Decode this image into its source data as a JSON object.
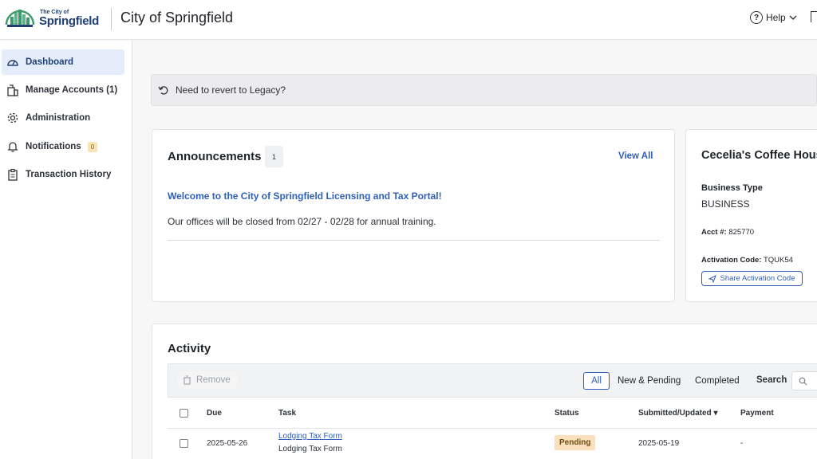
{
  "header": {
    "logo_small": "The City of",
    "logo_big": "Springfield",
    "title": "City of Springfield",
    "help_label": "Help"
  },
  "sidebar": {
    "items": [
      {
        "label": "Dashboard",
        "icon": "gauge-icon",
        "active": true
      },
      {
        "label": "Manage Accounts (1)",
        "icon": "building-icon"
      },
      {
        "label": "Administration",
        "icon": "gear-icon"
      },
      {
        "label": "Notifications",
        "icon": "bell-icon",
        "badge": "0"
      },
      {
        "label": "Transaction History",
        "icon": "clipboard-icon"
      }
    ]
  },
  "legacy_banner": {
    "text": "Need to revert to Legacy?"
  },
  "announcements": {
    "title": "Announcements",
    "count": "1",
    "view_all": "View All",
    "heading": "Welcome to the City of Springfield Licensing and Tax Portal!",
    "body": "Our offices will be closed from 02/27 - 02/28 for annual training."
  },
  "business": {
    "name": "Cecelia's Coffee House",
    "type_label": "Business Type",
    "type_value": "BUSINESS",
    "acct_label": "Acct #:",
    "acct_value": "825770",
    "activation_label": "Activation Code:",
    "activation_value": "TQUK54",
    "share_button": "Share Activation Code"
  },
  "activity": {
    "title": "Activity",
    "remove_button": "Remove",
    "filters": [
      "All",
      "New & Pending",
      "Completed"
    ],
    "active_filter": "All",
    "search_label": "Search",
    "columns": [
      "Due",
      "Task",
      "Status",
      "Submitted/Updated ▾",
      "Payment"
    ],
    "rows": [
      {
        "due": "2025-05-26",
        "task_link": "Lodging Tax Form",
        "task_sub": "Lodging Tax Form",
        "status": "Pending",
        "submitted": "2025-05-19",
        "payment": "-"
      }
    ]
  },
  "colors": {
    "accent": "#2f5fb8",
    "brand_navy": "#1f3f75",
    "pending_bg": "#fbe0bd",
    "active_nav_bg": "#e5edfb"
  }
}
